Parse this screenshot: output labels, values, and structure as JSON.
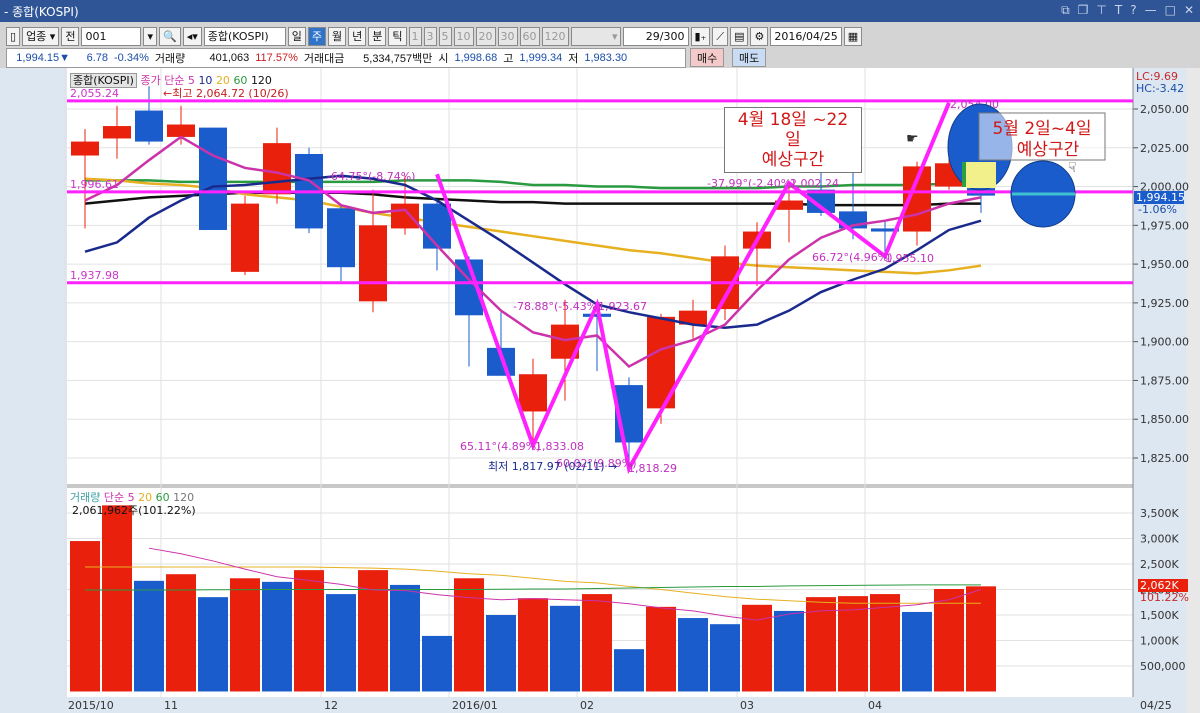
{
  "window": {
    "title": "- 종합(KOSPI)",
    "controls": [
      "⧉",
      "❐",
      "⊤",
      "T",
      "?",
      "—",
      "□",
      "✕"
    ]
  },
  "toolbar": {
    "market": "업종",
    "prev": "전",
    "code": "001",
    "name": "종합(KOSPI)",
    "periods": [
      "일",
      "주",
      "월",
      "년",
      "분",
      "틱"
    ],
    "selected_period": "주",
    "intervals": [
      "1",
      "3",
      "5",
      "10",
      "20",
      "30",
      "60",
      "120"
    ],
    "count": "29/300",
    "date": "2016/04/25"
  },
  "info": {
    "price": "1,994.15",
    "arrow": "▼",
    "change": "6.78",
    "change_pct": "-0.34%",
    "volume_label": "거래량",
    "volume": "401,063",
    "volume_pct": "117.57%",
    "amount_label": "거래대금",
    "amount": "5,334,757백만",
    "open_label": "시",
    "open": "1,998.68",
    "high_label": "고",
    "high": "1,999.34",
    "low_label": "저",
    "low": "1,983.30",
    "buy": "매수",
    "sell": "매도"
  },
  "legend": {
    "symbol": "종합(KOSPI)",
    "ma_label": "종가 단순 5",
    "ma10": "10",
    "ma20": "20",
    "ma60": "60",
    "ma120": "120",
    "high_marker": "←최고 2,064.72 (10/26)",
    "low_marker": "최저 1,817.97 (02/11) →",
    "lc": "LC:9.69",
    "hc": "HC:-3.42",
    "current": "1,994.15",
    "current_pct": "-1.06%"
  },
  "volume_legend": {
    "label": "거래량",
    "ma_label": "단순 5",
    "ma20": "20",
    "ma60": "60",
    "ma120": "120",
    "current": "2,061,962주(101.22%)",
    "axis_current": "2,062K",
    "axis_pct": "101.22%"
  },
  "annotations": {
    "box1_line1": "4월 18일 ~22일",
    "box1_line2": "예상구간",
    "box2_line1": "5월  2일~4일",
    "box2_line2": "예상구간",
    "lines": [
      {
        "label": "2,055.24",
        "price": 2055.24
      },
      {
        "label": "1,996.61",
        "price": 1996.61
      },
      {
        "label": "1,937.98",
        "price": 1937.98
      }
    ],
    "texts": [
      "-64.75°(-8.74%)",
      "-78.88°(-5.43%)",
      "1,923.67",
      "65.11°(4.89%)",
      "1,833.08",
      "60.02°(9.89%)",
      "1,818.29",
      "-37.99°(-2.40%)",
      "2,002.24",
      "66.72°(4.96%)",
      "1,955.10",
      "2,054.00"
    ]
  },
  "colors": {
    "up": "#e8200c",
    "down": "#1a5ccc",
    "ma5": "#cc33aa",
    "ma10": "#1a2a8c",
    "ma20": "#e6b020",
    "ma60": "#2a9a40",
    "ma120": "#111111",
    "trend": "#ff22ff"
  },
  "chart_data": {
    "type": "candlestick",
    "title": "종합(KOSPI) 주봉",
    "x_labels": [
      {
        "i": 0,
        "label": "2015/10"
      },
      {
        "i": 3,
        "label": "11"
      },
      {
        "i": 8,
        "label": "12"
      },
      {
        "i": 12,
        "label": "2016/01"
      },
      {
        "i": 16,
        "label": "02"
      },
      {
        "i": 21,
        "label": "03"
      },
      {
        "i": 25,
        "label": "04"
      }
    ],
    "x_end_label": "04/25",
    "ylim": [
      1810,
      2070
    ],
    "y_ticks": [
      2050,
      2025,
      2000,
      1975,
      1950,
      1925,
      1900,
      1875,
      1850,
      1825
    ],
    "y_tick_labels": [
      "2,050.00",
      "2,025.00",
      "2,000.00",
      "1,975.00",
      "1,950.00",
      "1,925.00",
      "1,900.00",
      "1,875.00",
      "1,850.00",
      "1,825.00"
    ],
    "ohlc": [
      [
        2020,
        2037,
        1973,
        2029
      ],
      [
        2031,
        2052,
        2018,
        2039
      ],
      [
        2049,
        2064.7,
        2027,
        2029
      ],
      [
        2032,
        2052,
        2027,
        2040
      ],
      [
        2038,
        2038,
        1972,
        1972
      ],
      [
        1945,
        1994,
        1943,
        1989
      ],
      [
        1995,
        2038,
        1989,
        2028
      ],
      [
        2021,
        2025,
        1970,
        1973
      ],
      [
        1986,
        1988,
        1939,
        1948
      ],
      [
        1926,
        1998,
        1919,
        1975
      ],
      [
        1973,
        2007,
        1969,
        1989
      ],
      [
        1989,
        1992,
        1946,
        1960
      ],
      [
        1953,
        1955,
        1884,
        1917
      ],
      [
        1896,
        1919,
        1884,
        1878
      ],
      [
        1855,
        1889,
        1833.08,
        1879
      ],
      [
        1889,
        1927,
        1862,
        1911
      ],
      [
        1918,
        1923.67,
        1881,
        1916
      ],
      [
        1872,
        1877,
        1818.29,
        1835
      ],
      [
        1857,
        1918,
        1847,
        1916
      ],
      [
        1911,
        1927,
        1902,
        1920
      ],
      [
        1921,
        1962,
        1914,
        1955
      ],
      [
        1960,
        1977,
        1936,
        1971
      ],
      [
        1985,
        2002.24,
        1964,
        1991
      ],
      [
        1998,
        2009,
        1981,
        1983
      ],
      [
        1984,
        2009,
        1966,
        1973
      ],
      [
        1973,
        1978,
        1955.1,
        1971
      ],
      [
        1971,
        2016,
        1962,
        2013
      ],
      [
        2000,
        2023,
        1998,
        2015
      ],
      [
        1999,
        2016,
        1983,
        1994.15
      ]
    ],
    "ma5": [
      1991,
      2001,
      2017,
      2032,
      2020,
      2012,
      2009,
      2004,
      1988,
      1983,
      1985,
      1962,
      1940,
      1920,
      1906,
      1901,
      1904,
      1884,
      1895,
      1901,
      1911,
      1933,
      1953,
      1967,
      1975,
      1978,
      1982,
      1989,
      1993
    ],
    "ma10": [
      1958,
      1964,
      1980,
      1991,
      2000,
      2001,
      2003,
      2005,
      2007,
      2005,
      2001,
      1991,
      1978,
      1965,
      1951,
      1937,
      1924,
      1919,
      1915,
      1911,
      1909,
      1911,
      1920,
      1932,
      1940,
      1947,
      1959,
      1972,
      1978
    ],
    "ma20": [
      2005,
      2004,
      2002,
      2001,
      1999,
      1995,
      1993,
      1991,
      1987,
      1983,
      1980,
      1977,
      1974,
      1971,
      1968,
      1965,
      1962,
      1959,
      1957,
      1954,
      1951,
      1949,
      1948,
      1947,
      1946,
      1945,
      1944,
      1946,
      1949
    ],
    "ma60": [
      2004,
      2004,
      2004,
      2003,
      2003,
      2003,
      2003,
      2003,
      2003,
      2003,
      2004,
      2004,
      2004,
      2003,
      2001,
      2001,
      2000,
      2000,
      1999,
      1999,
      1999,
      1999,
      2000,
      2000,
      2001,
      2001,
      2001,
      2002,
      2002
    ],
    "ma120": [
      1989,
      1991,
      1993,
      1994,
      1995,
      1996,
      1996,
      1996,
      1996,
      1995,
      1993,
      1992,
      1991,
      1990,
      1990,
      1989,
      1989,
      1989,
      1989,
      1989,
      1989,
      1989,
      1989,
      1988,
      1988,
      1988,
      1988,
      1989,
      1989
    ],
    "trendline": [
      [
        11,
        2008
      ],
      [
        14,
        1833.08
      ],
      [
        16,
        1923.67
      ],
      [
        17,
        1818.29
      ],
      [
        22,
        2002.24
      ],
      [
        25,
        1955.1
      ],
      [
        27,
        2054
      ]
    ],
    "volume": {
      "unit": "K",
      "ylim": [
        0,
        3800
      ],
      "y_ticks": [
        3500,
        3000,
        2500,
        2000,
        1500,
        1000,
        500
      ],
      "y_tick_labels": [
        "3,500K",
        "3,000K",
        "2,500K",
        "2,000K",
        "1,500K",
        "1,000K",
        "500,000"
      ],
      "values": [
        2950,
        3650,
        2170,
        2300,
        1850,
        2220,
        2150,
        2380,
        1910,
        2380,
        2090,
        1090,
        2220,
        1500,
        1830,
        1680,
        1910,
        830,
        1660,
        1440,
        1320,
        1700,
        1580,
        1850,
        1870,
        1910,
        1560,
        2010,
        2062
      ],
      "up": [
        1,
        1,
        0,
        1,
        0,
        1,
        0,
        1,
        0,
        1,
        0,
        0,
        1,
        0,
        1,
        0,
        1,
        0,
        1,
        0,
        0,
        1,
        0,
        1,
        1,
        1,
        0,
        1,
        1
      ],
      "ma5": [
        null,
        null,
        2810,
        2700,
        2560,
        2400,
        2250,
        2180,
        2100,
        1990,
        1980,
        1900,
        1840,
        1800,
        1820,
        1800,
        1780,
        1720,
        1640,
        1580,
        1480,
        1400,
        1520,
        1580,
        1600,
        1650,
        1700,
        1800,
        2000
      ],
      "ma20": [
        2440,
        2440,
        2440,
        2440,
        2440,
        2440,
        2440,
        2440,
        2430,
        2420,
        2400,
        2360,
        2310,
        2280,
        2220,
        2160,
        2130,
        2060,
        2000,
        1930,
        1860,
        1810,
        1780,
        1750,
        1730,
        1730,
        1730,
        1730,
        1730
      ],
      "ma60": [
        1990,
        1990,
        1990,
        1990,
        1995,
        1995,
        2000,
        2000,
        2000,
        2000,
        2000,
        2000,
        2000,
        2005,
        2010,
        2010,
        2020,
        2030,
        2040,
        2050,
        2060,
        2060,
        2070,
        2075,
        2080,
        2085,
        2090,
        2090,
        2090
      ]
    }
  }
}
